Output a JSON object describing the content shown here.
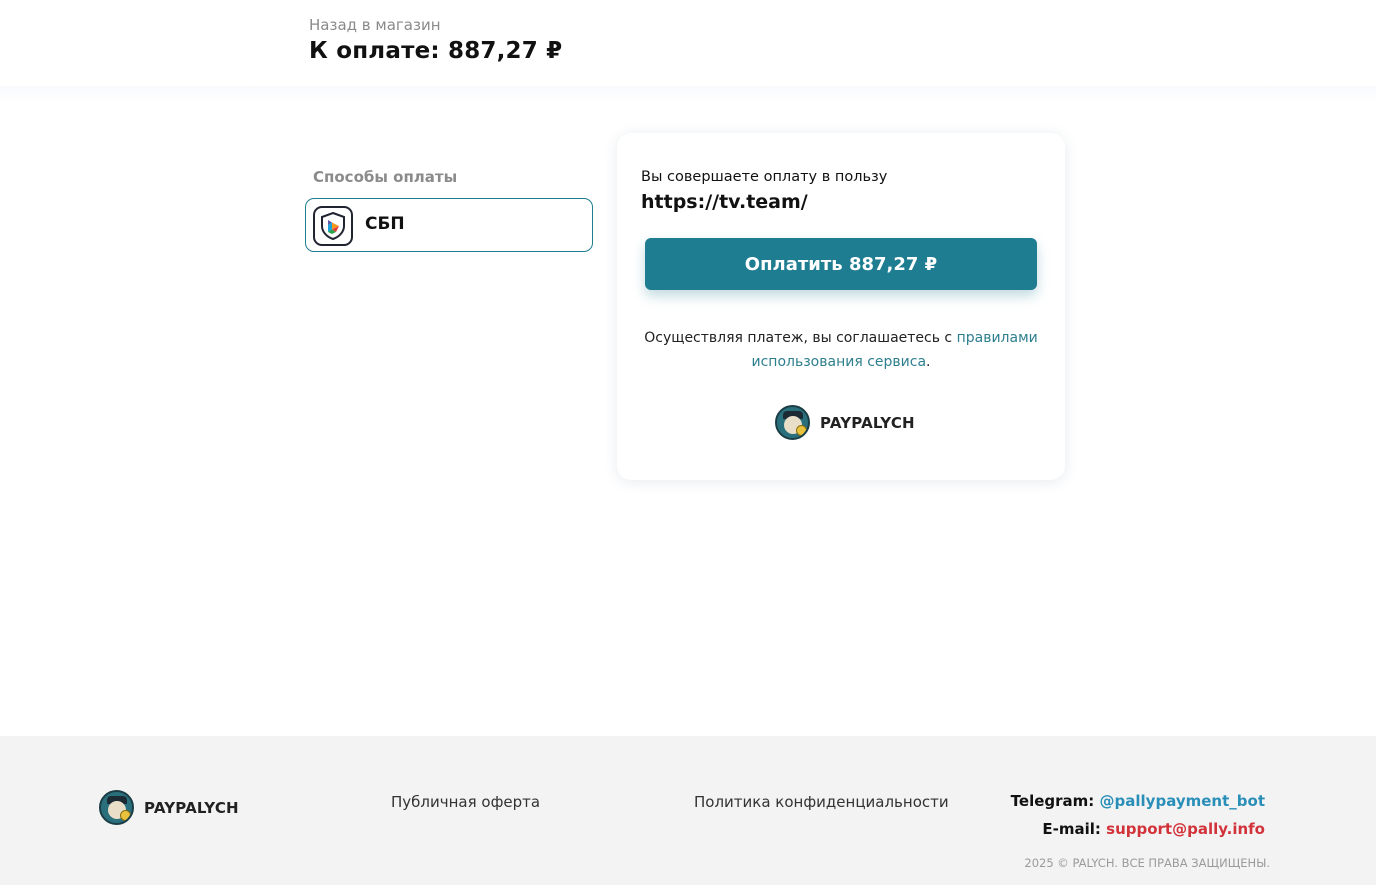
{
  "header": {
    "back_link": "Назад в магазин",
    "total": "К оплате: 887,27 ₽"
  },
  "methods": {
    "title": "Способы оплаты",
    "items": [
      {
        "label": "СБП",
        "icon": "sbp-icon",
        "selected": true
      }
    ]
  },
  "payment": {
    "payee_caption": "Вы совершаете оплату в пользу",
    "payee_url": "https://tv.team/",
    "pay_button": "Оплатить 887,27 ₽",
    "terms_text": "Осуществляя платеж, вы соглашаетесь с ",
    "terms_link": "правилами использования сервиса",
    "terms_end": ".",
    "brand": "PAYPALYCH"
  },
  "footer": {
    "brand": "PAYPALYCH",
    "offer_link": "Публичная оферта",
    "privacy_link": "Политика конфиденциальности",
    "telegram_label": "Telegram:",
    "telegram_value": "@pallypayment_bot",
    "email_label": "E-mail:",
    "email_value": "support@pally.info",
    "copyright": "2025 © PALYCH. ВСЕ ПРАВА ЗАЩИЩЕНЫ."
  },
  "colors": {
    "accent": "#1f7d91",
    "telegram": "#2a8fb8",
    "email": "#d2333b",
    "footer_bg": "#f3f3f3"
  }
}
